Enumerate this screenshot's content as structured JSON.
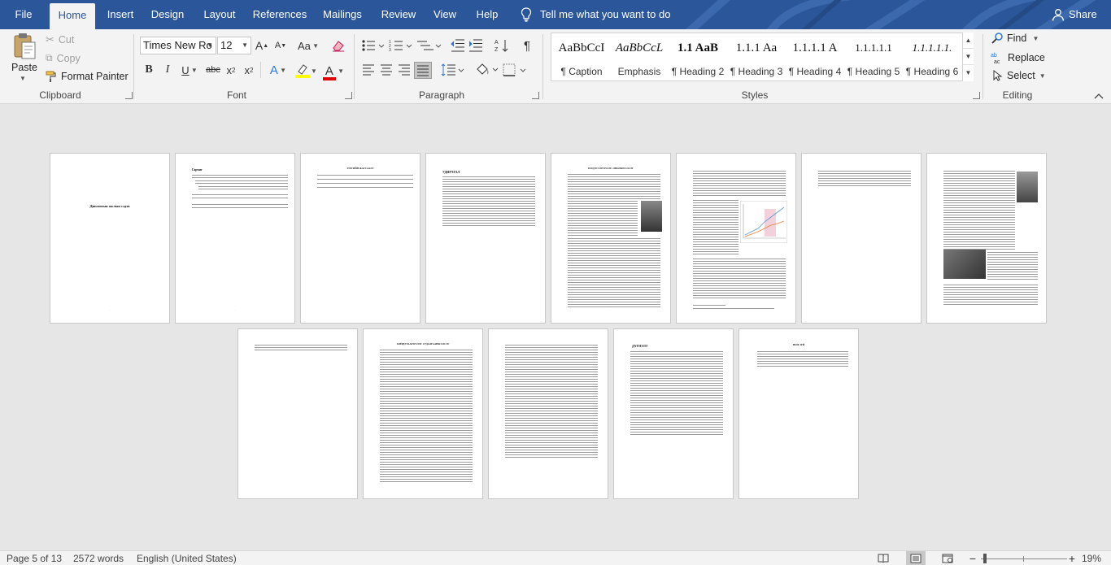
{
  "tabs": {
    "file": "File",
    "home": "Home",
    "insert": "Insert",
    "design": "Design",
    "layout": "Layout",
    "references": "References",
    "mailings": "Mailings",
    "review": "Review",
    "view": "View",
    "help": "Help"
  },
  "tell_me": "Tell me what you want to do",
  "share": "Share",
  "clipboard": {
    "paste": "Paste",
    "cut": "Cut",
    "copy": "Copy",
    "format_painter": "Format Painter",
    "label": "Clipboard"
  },
  "font": {
    "name": "Times New Ro",
    "size": "12",
    "label": "Font",
    "grow": "A",
    "shrink": "A",
    "change_case": "Aa",
    "bold": "B",
    "italic": "I",
    "underline": "U",
    "strikethrough": "abc",
    "subscript": "x",
    "subscript_mark": "2",
    "superscript": "x",
    "superscript_mark": "2",
    "text_effects": "A",
    "font_color": "A"
  },
  "paragraph": {
    "label": "Paragraph"
  },
  "styles": {
    "label": "Styles",
    "items": [
      {
        "preview": "AaBbCcI",
        "name": "¶ Caption"
      },
      {
        "preview": "AaBbCcL",
        "name": "Emphasis"
      },
      {
        "preview": "1.1  AaB",
        "name": "¶ Heading 2"
      },
      {
        "preview": "1.1.1  Aa",
        "name": "¶ Heading 3"
      },
      {
        "preview": "1.1.1.1  A",
        "name": "¶ Heading 4"
      },
      {
        "preview": "1.1.1.1.1",
        "name": "¶ Heading 5"
      },
      {
        "preview": "1.1.1.1.1.",
        "name": "¶ Heading 6"
      }
    ]
  },
  "editing": {
    "label": "Editing",
    "find": "Find",
    "replace": "Replace",
    "select": "Select"
  },
  "pages_row1": [
    {
      "title": "Дипломын ажлын сэдэв"
    },
    {
      "title": "Гарчиг"
    },
    {
      "title": "ЗУРГИЙН ЖАГСААЛТ"
    },
    {
      "title": "УДИРТГАЛ"
    },
    {
      "title": "НЭГДҮГЭЭР БҮЛЭГ. ОНОЛЫН ХЭСЭГ"
    },
    {
      "title": ""
    },
    {
      "title": ""
    },
    {
      "title": ""
    }
  ],
  "pages_row2": [
    {
      "title": ""
    },
    {
      "title": "ХОЁРДУГААР БҮЛЭГ. СУДАЛГААНЫ ХЭСЭГ"
    },
    {
      "title": ""
    },
    {
      "title": "ДҮГНЭЛТ"
    },
    {
      "title": "НОМ ЗҮЙ"
    }
  ],
  "status": {
    "page": "Page 5 of 13",
    "words": "2572 words",
    "language": "English (United States)",
    "zoom": "19%"
  },
  "colors": {
    "ribbon_blue": "#2b579a",
    "highlight": "#ffff00",
    "font_color": "#e00000"
  }
}
